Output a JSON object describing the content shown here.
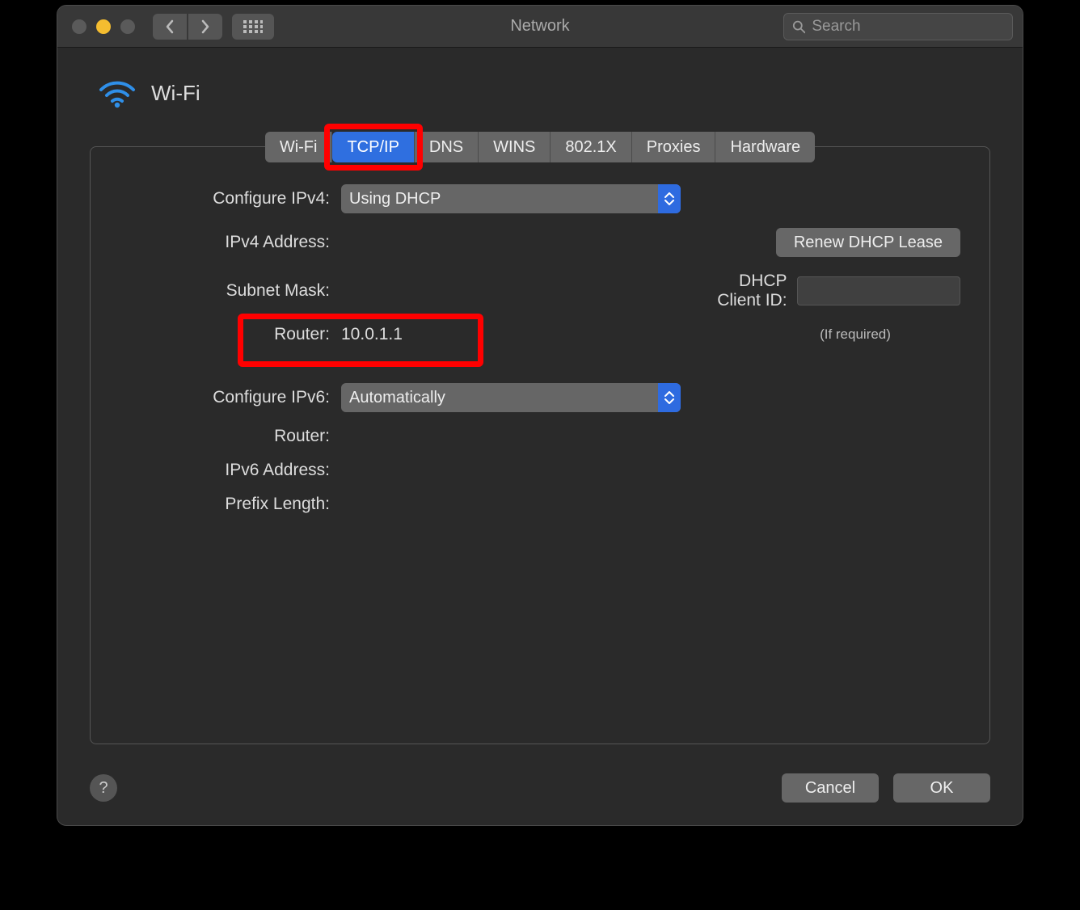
{
  "window": {
    "title": "Network"
  },
  "search": {
    "placeholder": "Search"
  },
  "header": {
    "interface_name": "Wi-Fi"
  },
  "tabs": [
    {
      "label": "Wi-Fi",
      "active": false
    },
    {
      "label": "TCP/IP",
      "active": true
    },
    {
      "label": "DNS",
      "active": false
    },
    {
      "label": "WINS",
      "active": false
    },
    {
      "label": "802.1X",
      "active": false
    },
    {
      "label": "Proxies",
      "active": false
    },
    {
      "label": "Hardware",
      "active": false
    }
  ],
  "ipv4": {
    "configure_label": "Configure IPv4:",
    "configure_value": "Using DHCP",
    "address_label": "IPv4 Address:",
    "address_value": "",
    "subnet_label": "Subnet Mask:",
    "subnet_value": "",
    "router_label": "Router:",
    "router_value": "10.0.1.1",
    "renew_button": "Renew DHCP Lease",
    "dhcp_client_id_label": "DHCP Client ID:",
    "dhcp_client_id_value": "",
    "dhcp_client_id_hint": "(If required)"
  },
  "ipv6": {
    "configure_label": "Configure IPv6:",
    "configure_value": "Automatically",
    "router_label": "Router:",
    "router_value": "",
    "address_label": "IPv6 Address:",
    "address_value": "",
    "prefix_label": "Prefix Length:",
    "prefix_value": ""
  },
  "footer": {
    "help": "?",
    "cancel": "Cancel",
    "ok": "OK"
  },
  "annotations": {
    "highlight_tab_index": 1,
    "highlight_router": true
  }
}
